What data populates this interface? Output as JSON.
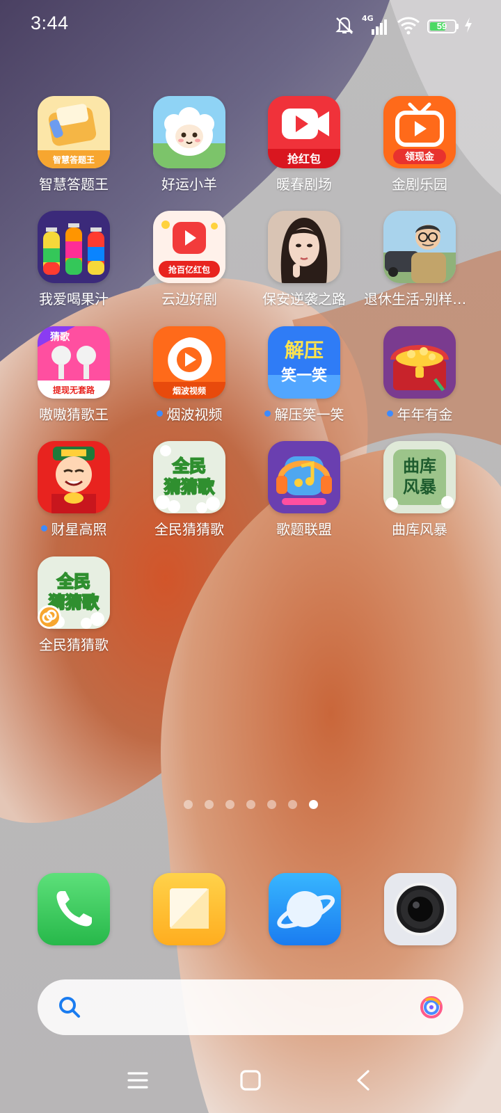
{
  "status_bar": {
    "time": "3:44",
    "network": "4G",
    "battery": "59",
    "icons": [
      "mute-icon",
      "signal-icon",
      "wifi-icon",
      "battery-icon",
      "charging-icon"
    ]
  },
  "apps": [
    {
      "label": "智慧答题王",
      "badge_text": "智慧答题王",
      "dot": false
    },
    {
      "label": "好运小羊",
      "dot": false
    },
    {
      "label": "暖春剧场",
      "badge_text": "抢红包",
      "dot": false
    },
    {
      "label": "金剧乐园",
      "badge_text": "领现金",
      "dot": false
    },
    {
      "label": "我爱喝果汁",
      "dot": false
    },
    {
      "label": "云边好剧",
      "badge_text": "抢百亿红包",
      "dot": false
    },
    {
      "label": "保安逆袭之路",
      "dot": false
    },
    {
      "label": "退休生活-别样人生",
      "dot": false
    },
    {
      "label": "嗷嗷猜歌王",
      "badge_text": "猜歌",
      "badge_text_2": "提现无套路",
      "dot": false
    },
    {
      "label": "烟波视频",
      "badge_text": "烟波视频",
      "dot": true
    },
    {
      "label": "解压笑一笑",
      "badge_text": "解压",
      "badge_text_2": "笑一笑",
      "dot": true
    },
    {
      "label": "年年有金",
      "dot": true
    },
    {
      "label": "财星高照",
      "dot": true
    },
    {
      "label": "全民猜猜歌",
      "badge_text": "全民",
      "badge_text_2": "猜猜歌",
      "dot": false
    },
    {
      "label": "歌题联盟",
      "dot": false
    },
    {
      "label": "曲库风暴",
      "badge_text": "曲库",
      "badge_text_2": "风暴",
      "dot": false
    },
    {
      "label": "全民猜猜歌",
      "badge_text": "全民",
      "badge_text_2": "猜猜歌",
      "dot": false
    }
  ],
  "page_indicator": {
    "count": 7,
    "active_index": 6
  },
  "dock": [
    {
      "name": "phone",
      "icon": "phone-icon"
    },
    {
      "name": "notes",
      "icon": "notes-icon"
    },
    {
      "name": "browser",
      "icon": "browser-icon"
    },
    {
      "name": "camera",
      "icon": "camera-icon"
    }
  ],
  "search": {
    "placeholder": ""
  },
  "nav": [
    "menu-icon",
    "home-icon",
    "back-icon"
  ],
  "colors": {
    "accent_dot": "#3d8bff",
    "battery_fill": "#4cd964"
  }
}
